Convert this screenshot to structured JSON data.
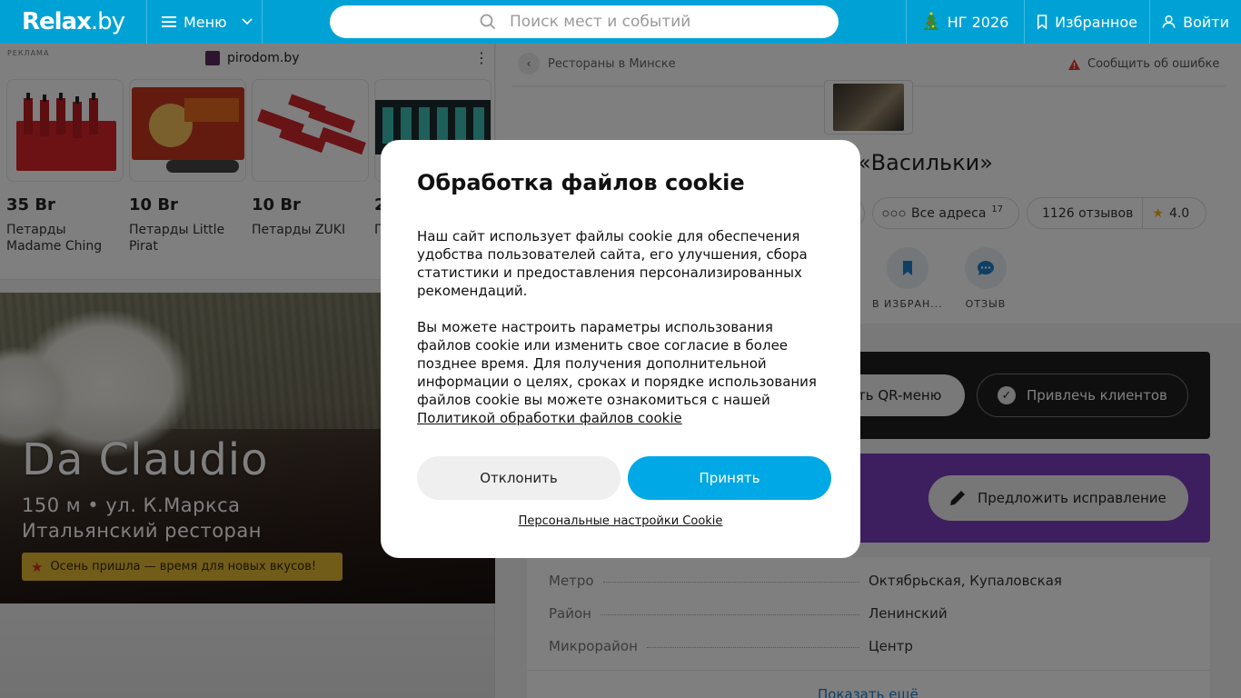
{
  "header": {
    "logo_main": "Relax",
    "logo_domain": ".by",
    "menu_label": "Меню",
    "search_placeholder": "Поиск мест и событий",
    "ng_label": "НГ 2026",
    "favorites_label": "Избранное",
    "login_label": "Войти",
    "colors": {
      "bar": "#00a2d6"
    }
  },
  "ad": {
    "label": "РЕКЛАМА",
    "brand": "pirodom.by",
    "items": [
      {
        "price": "35 Br",
        "name": "Петарды Madame Ching"
      },
      {
        "price": "10 Br",
        "name": "Петарды Little Pirat"
      },
      {
        "price": "10 Br",
        "name": "Петарды ZUKI"
      },
      {
        "price": "2",
        "name": "П П"
      }
    ]
  },
  "hero": {
    "title": "Da Claudio",
    "subtitle_line1": "150 м • ул. К.Маркса",
    "subtitle_line2": "Итальянский ресторан",
    "badge": "Осень пришла — время для новых вкусов!"
  },
  "place": {
    "breadcrumb": "Рестораны в Минске",
    "report": "Сообщить об ошибке",
    "name_partial": "«Васильки»",
    "addresses_label": "Все адреса",
    "addresses_count": "17",
    "reviews_label": "1126 отзывов",
    "rating": "4.0",
    "actions": [
      {
        "label": "В ИЗБРАН...",
        "icon": "bookmark-icon"
      },
      {
        "label": "ОТЗЫВ",
        "icon": "chat-icon"
      }
    ],
    "qr_label": "ть QR-меню",
    "clients_label": "Привлечь клиентов",
    "suggest_label": "Предложить исправление",
    "info": [
      {
        "key": "Метро",
        "value": "Октябрьская, Купаловская"
      },
      {
        "key": "Район",
        "value": "Ленинский"
      },
      {
        "key": "Микрорайон",
        "value": "Центр"
      }
    ],
    "show_more": "Показать ещё"
  },
  "cookie": {
    "title": "Обработка файлов cookie",
    "p1": "Наш сайт использует файлы cookie для обеспечения удобства пользователей сайта, его улучшения, сбора статистики и предоставления персонализированных рекомендаций.",
    "p2": "Вы можете настроить параметры использования файлов cookie или изменить свое согласие в более позднее время. Для получения дополнительной информации о целях, сроках и порядке использования файлов cookie вы можете ознакомиться с нашей",
    "policy_link": "Политикой обработки файлов cookie",
    "decline": "Отклонить",
    "accept": "Принять",
    "personal": "Персональные настройки Cookie",
    "colors": {
      "accept": "#00a8e6"
    }
  }
}
